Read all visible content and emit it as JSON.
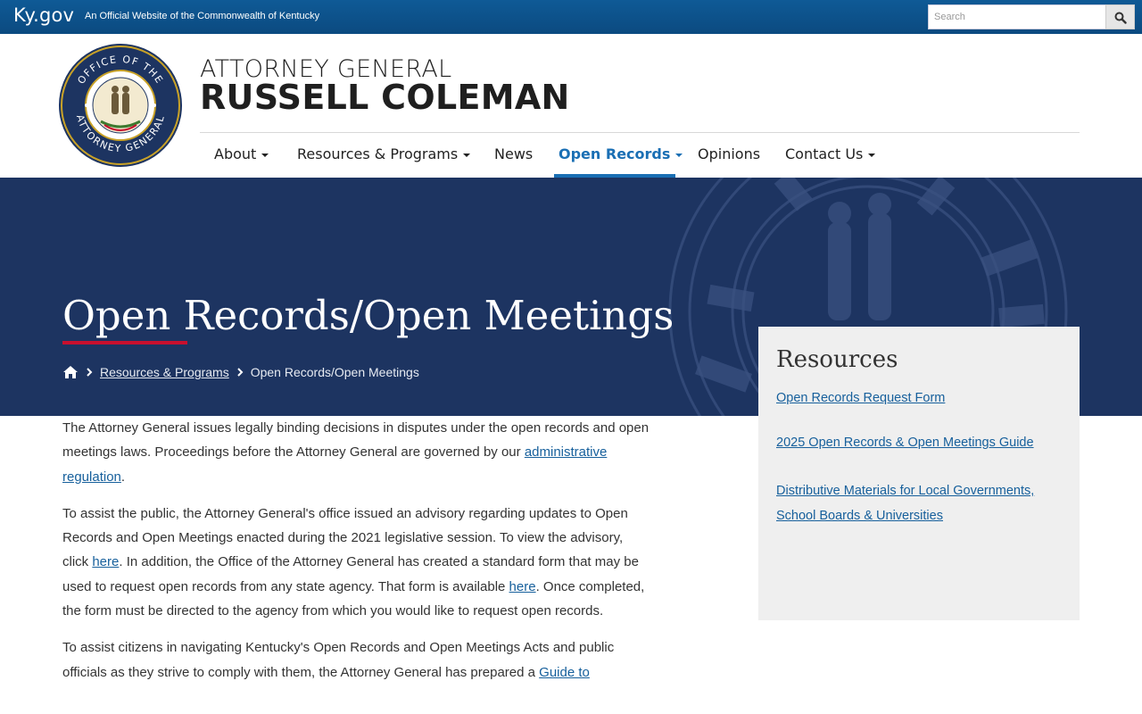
{
  "topbar": {
    "brand": "Ky.gov",
    "tagline": "An Official Website of the Commonwealth of Kentucky",
    "search_placeholder": "Search"
  },
  "header": {
    "title_small": "ATTORNEY GENERAL",
    "title_big": "RUSSELL COLEMAN",
    "seal_text_top": "OFFICE OF THE",
    "seal_text_bottom": "ATTORNEY GENERAL"
  },
  "nav": {
    "items": [
      {
        "label": "About",
        "dropdown": true
      },
      {
        "label": "Resources & Programs",
        "dropdown": true
      },
      {
        "label": "News",
        "dropdown": false
      },
      {
        "label": "Open Records",
        "dropdown": true,
        "active": true
      },
      {
        "label": "Opinions",
        "dropdown": false
      },
      {
        "label": "Contact Us",
        "dropdown": true
      }
    ]
  },
  "hero": {
    "title": "Open Records/Open Meetings",
    "breadcrumb": {
      "link": "Resources & Programs",
      "current": "Open Records/Open Meetings"
    }
  },
  "resources": {
    "heading": "Resources",
    "links": [
      "Open Records Request Form",
      "2025 Open Records & Open Meetings Guide",
      "Distributive Materials for Local Governments, School Boards & Universities"
    ]
  },
  "content": {
    "p1_text": "The Attorney General issues legally binding decisions in disputes under the open records and open meetings laws. Proceedings before the Attorney General are governed by our ",
    "p1_link": "administrative regulation",
    "p1_end": ".",
    "p2_a": "To assist the public, the Attorney General's office issued an advisory regarding updates to Open Records and Open Meetings enacted during the 2021 legislative session. To view the advisory, click ",
    "p2_link1": "here",
    "p2_b": ". In addition, the Office of the Attorney General has created a standard form that may be used to request open records from any state agency. That form is available ",
    "p2_link2": "here",
    "p2_c": ". Once completed, the form must be directed to the agency from which you would like to request open records.",
    "p3_a": "To assist citizens in navigating Kentucky's Open Records and Open Meetings Acts and public officials as they strive to comply with them, the Attorney General has prepared a ",
    "p3_link": "Guide to"
  },
  "colors": {
    "topbar": "#0b4a80",
    "hero": "#1d3461",
    "accent_red": "#c8102e",
    "link": "#17609c",
    "nav_active": "#1a6fb4"
  }
}
